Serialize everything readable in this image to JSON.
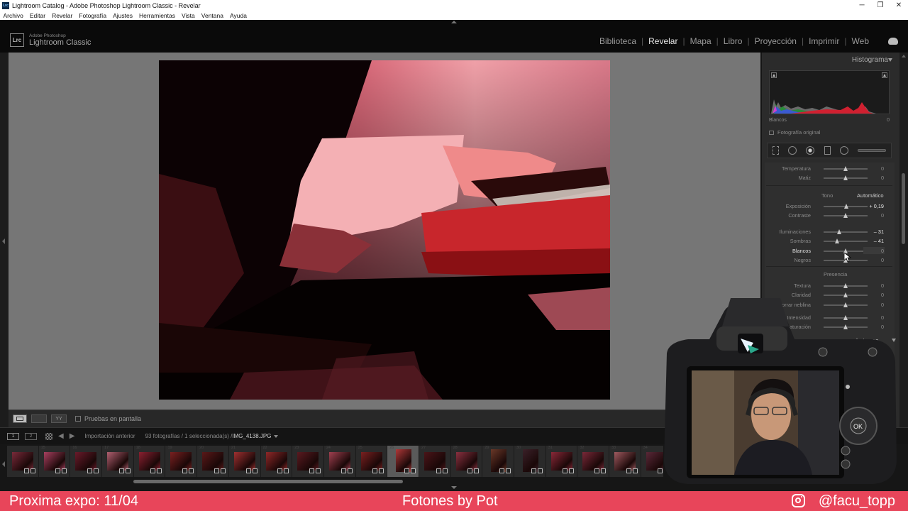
{
  "window": {
    "title": "Lightroom Catalog - Adobe Photoshop Lightroom Classic - Revelar",
    "app_icon": "Lrc",
    "minimize": "─",
    "maximize": "❐",
    "close": "✕"
  },
  "menu": [
    "Archivo",
    "Editar",
    "Revelar",
    "Fotografía",
    "Ajustes",
    "Herramientas",
    "Vista",
    "Ventana",
    "Ayuda"
  ],
  "brand": {
    "icon": "Lrc",
    "small": "Adobe Photoshop",
    "big": "Lightroom Classic"
  },
  "modules": [
    {
      "label": "Biblioteca",
      "active": false
    },
    {
      "label": "Revelar",
      "active": true
    },
    {
      "label": "Mapa",
      "active": false
    },
    {
      "label": "Libro",
      "active": false
    },
    {
      "label": "Proyección",
      "active": false
    },
    {
      "label": "Imprimir",
      "active": false
    },
    {
      "label": "Web",
      "active": false
    }
  ],
  "toolbar": {
    "soft_proof_label": "Pruebas en pantalla",
    "compare_label": "YY"
  },
  "right_panel": {
    "histogram_title": "Histograma",
    "histogram_readout_label": "Blancos",
    "histogram_readout_value": "0",
    "original_photo_label": "Fotografía original",
    "tone_label": "Tono",
    "auto_label": "Automático",
    "presence_label": "Presencia",
    "curve_title": "de tonos",
    "adjustments": [
      {
        "key": "temperatura",
        "label": "Temperatura",
        "value": "0",
        "pos": 0.5,
        "group": "wb",
        "row": 0
      },
      {
        "key": "matiz",
        "label": "Matiz",
        "value": "0",
        "pos": 0.5,
        "group": "wb",
        "row": 1
      },
      {
        "key": "exposicion",
        "label": "Exposición",
        "value": "+ 0,19",
        "pos": 0.52,
        "group": "tone",
        "row": 0,
        "changed": true
      },
      {
        "key": "contraste",
        "label": "Contraste",
        "value": "0",
        "pos": 0.5,
        "group": "tone",
        "row": 1
      },
      {
        "key": "iluminaciones",
        "label": "Iluminaciones",
        "value": "– 31",
        "pos": 0.35,
        "group": "tone2",
        "row": 0,
        "changed": true
      },
      {
        "key": "sombras",
        "label": "Sombras",
        "value": "– 41",
        "pos": 0.3,
        "group": "tone2",
        "row": 1,
        "changed": true
      },
      {
        "key": "blancos",
        "label": "Blancos",
        "value": "0",
        "pos": 0.5,
        "group": "tone2",
        "row": 2,
        "active": true
      },
      {
        "key": "negros",
        "label": "Negros",
        "value": "0",
        "pos": 0.5,
        "group": "tone2",
        "row": 3
      },
      {
        "key": "textura",
        "label": "Textura",
        "value": "0",
        "pos": 0.5,
        "group": "presence",
        "row": 0
      },
      {
        "key": "claridad",
        "label": "Claridad",
        "value": "0",
        "pos": 0.5,
        "group": "presence",
        "row": 1
      },
      {
        "key": "neblina",
        "label": "Borrar neblina",
        "value": "0",
        "pos": 0.5,
        "group": "presence",
        "row": 2
      },
      {
        "key": "intensidad",
        "label": "Intensidad",
        "value": "0",
        "pos": 0.5,
        "group": "presence2",
        "row": 0
      },
      {
        "key": "saturacion",
        "label": "Saturación",
        "value": "0",
        "pos": 0.5,
        "group": "presence2",
        "row": 1
      }
    ]
  },
  "filmstrip": {
    "monitor_1": "1",
    "monitor_2": "2",
    "source": "Importación anterior",
    "count_info": "93 fotografías / 1 seleccionada(s) /",
    "current_file": "IMG_4138.JPG",
    "thumbs": [
      {
        "n": "",
        "portrait": false,
        "tone": "#7a2a3a"
      },
      {
        "n": "15",
        "portrait": false,
        "tone": "#a84060"
      },
      {
        "n": "16",
        "portrait": false,
        "tone": "#6a1a2a"
      },
      {
        "n": "17",
        "portrait": false,
        "tone": "#b06070"
      },
      {
        "n": "18",
        "portrait": false,
        "tone": "#8a2030"
      },
      {
        "n": "19",
        "portrait": false,
        "tone": "#7a2020"
      },
      {
        "n": "20",
        "portrait": false,
        "tone": "#5a1818"
      },
      {
        "n": "21",
        "portrait": false,
        "tone": "#a03030"
      },
      {
        "n": "22",
        "portrait": false,
        "tone": "#902828"
      },
      {
        "n": "23",
        "portrait": false,
        "tone": "#5a1a20"
      },
      {
        "n": "24",
        "portrait": false,
        "tone": "#a04050"
      },
      {
        "n": "25",
        "portrait": false,
        "tone": "#7a2020"
      },
      {
        "n": "26",
        "portrait": true,
        "tone": "#b03838",
        "selected": true
      },
      {
        "n": "27",
        "portrait": false,
        "tone": "#4a1418"
      },
      {
        "n": "28",
        "portrait": false,
        "tone": "#8a3040"
      },
      {
        "n": "29",
        "portrait": true,
        "tone": "#6a3828"
      },
      {
        "n": "30",
        "portrait": true,
        "tone": "#3a2028"
      },
      {
        "n": "31",
        "portrait": false,
        "tone": "#8a2838"
      },
      {
        "n": "32",
        "portrait": false,
        "tone": "#7a2838"
      },
      {
        "n": "33",
        "portrait": false,
        "tone": "#a05a60"
      },
      {
        "n": "34",
        "portrait": false,
        "tone": "#5a2838"
      }
    ]
  },
  "banner": {
    "left": "Proxima expo: 11/04",
    "center": "Fotones by Pot",
    "right": "@facu_topp"
  },
  "colors": {
    "banner_bg": "#e8455a",
    "lr_dark": "#0a0a0a",
    "canvas_grey": "#767676"
  }
}
